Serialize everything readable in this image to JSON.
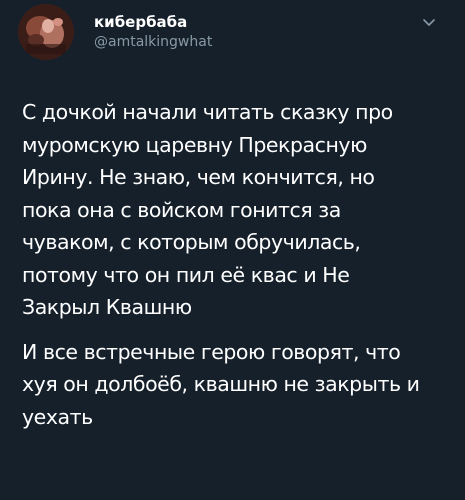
{
  "tweet": {
    "display_name": "кибербаба",
    "handle": "@amtalkingwhat",
    "menu_icon": "chevron-down-icon",
    "avatar_icon": "avatar",
    "paragraphs": [
      {
        "lines": [
          "С дочкой начали читать сказку про",
          "муромскую царевну Прекрасную",
          "Ирину. Не знаю, чем кончится, но",
          "пока она с войском гонится за",
          "чуваком, с которым обручилась,",
          "потому что он пил её квас и Не",
          "Закрыл Квашню"
        ]
      },
      {
        "lines": [
          "И все встречные герою говорят, что",
          "хуя он долбоёб, квашню не закрыть и",
          "уехать"
        ]
      }
    ]
  },
  "colors": {
    "background": "#15202b",
    "text": "#ffffff",
    "secondary_text": "#8899a6"
  }
}
